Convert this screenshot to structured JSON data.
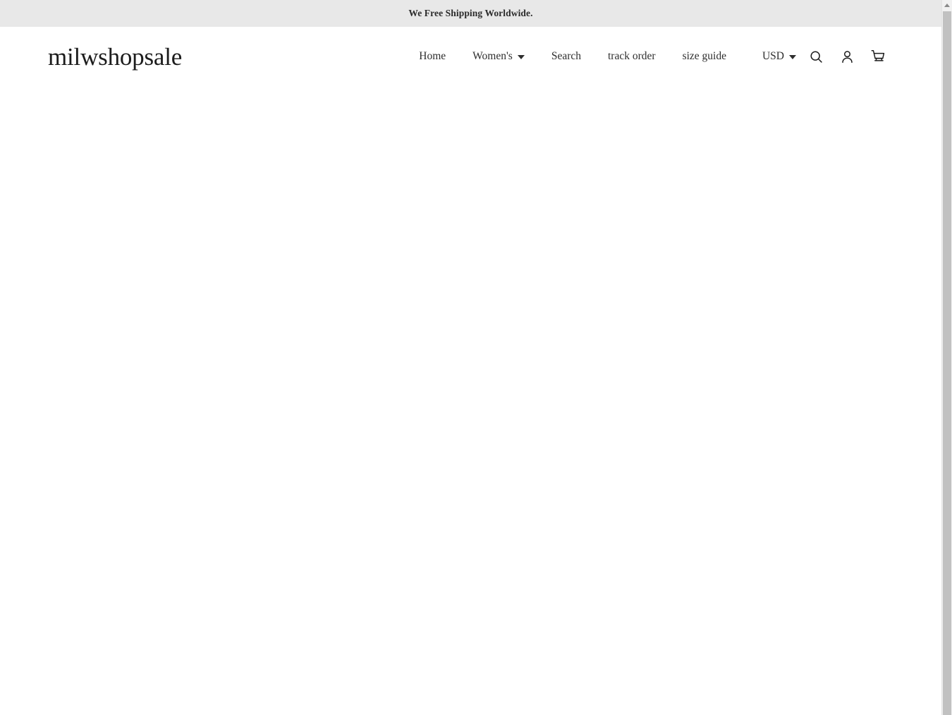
{
  "announcement": {
    "text": "We Free Shipping Worldwide."
  },
  "header": {
    "logo": "milwshopsale",
    "nav": [
      {
        "label": "Home",
        "has_caret": false
      },
      {
        "label": "Women's",
        "has_caret": true
      },
      {
        "label": "Search",
        "has_caret": false
      },
      {
        "label": "track order",
        "has_caret": false
      },
      {
        "label": "size guide",
        "has_caret": false
      }
    ],
    "currency": {
      "value": "USD",
      "caret_icon": "chevron-down-icon"
    },
    "icons": [
      {
        "name": "search-icon"
      },
      {
        "name": "account-icon"
      },
      {
        "name": "cart-icon"
      }
    ]
  },
  "main": {
    "content": ""
  },
  "scrollbar": {
    "up_arrow_icon": "arrow-up-icon"
  },
  "colors": {
    "announcement_bg": "#e8e8e8",
    "page_bg": "#ffffff",
    "text": "#2e2e2e",
    "logo": "#1c1c1c",
    "scrollbar_track": "#f1f1f1",
    "scrollbar_thumb": "#c1c1c1"
  }
}
